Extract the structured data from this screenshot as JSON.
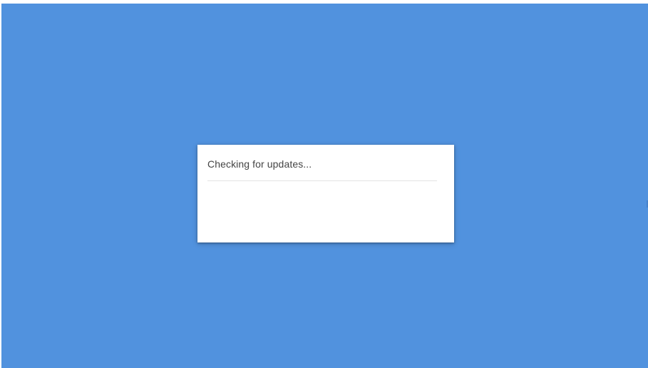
{
  "screen": {
    "background_color": "#5192de"
  },
  "dialog": {
    "message": "Checking for updates...",
    "progress": {
      "value": 0,
      "track_color": "#e3e3e3",
      "fill_color": "#4285f4"
    }
  }
}
